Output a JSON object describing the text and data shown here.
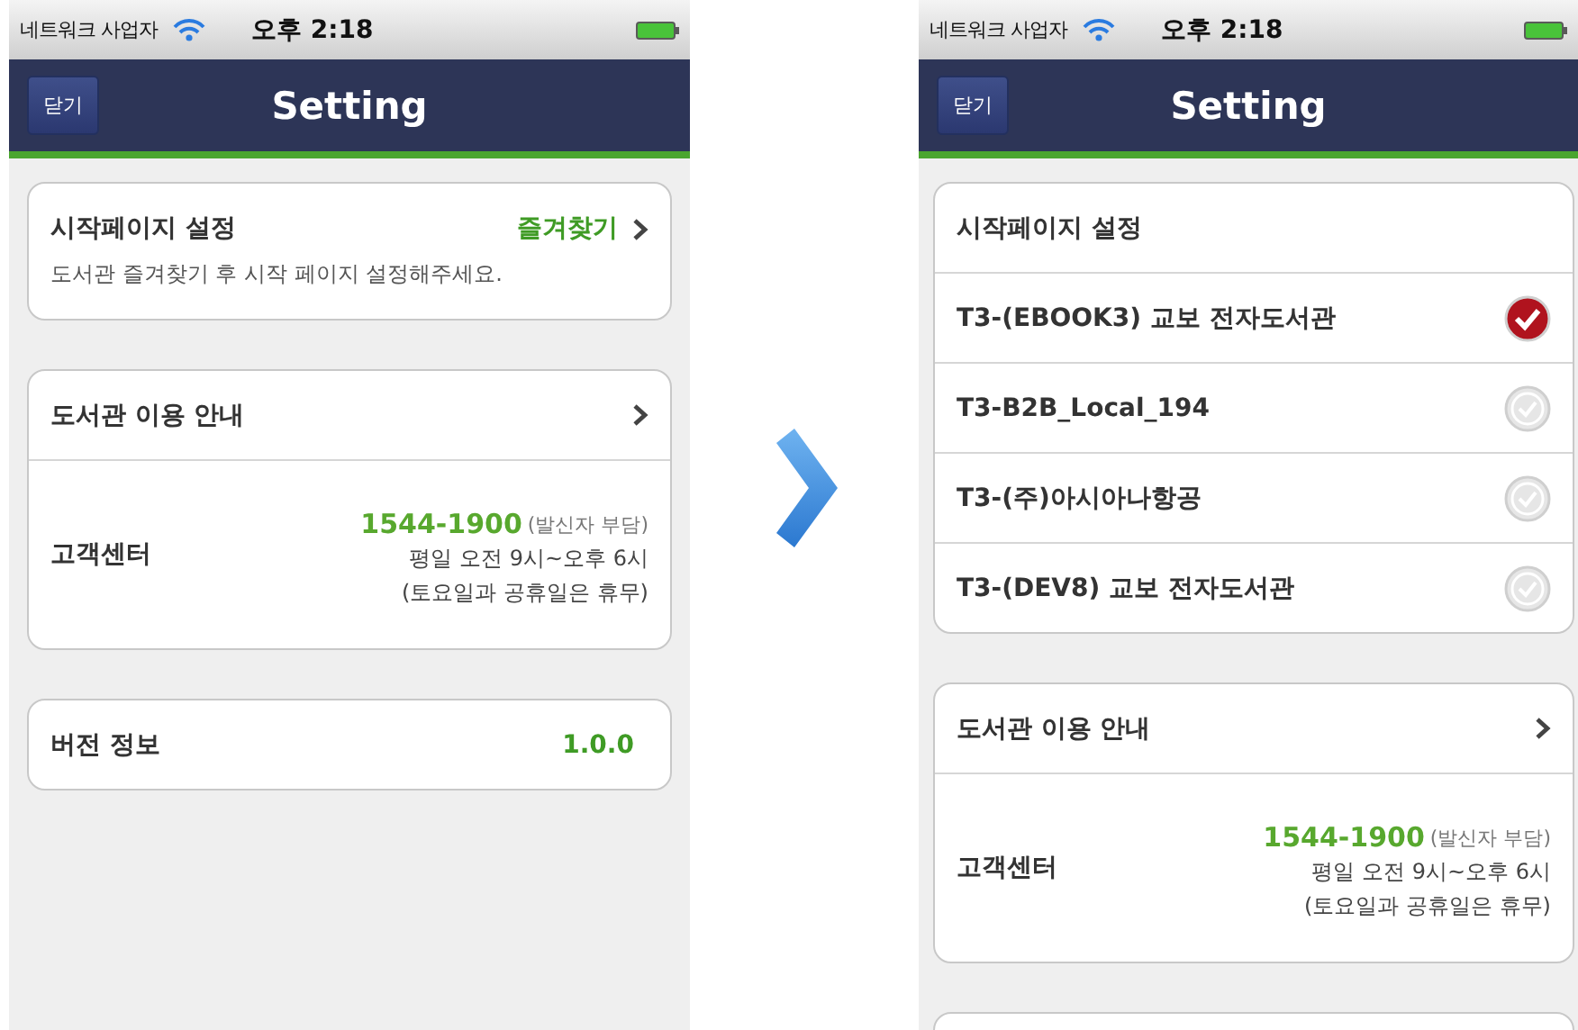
{
  "phones": [
    {
      "status_bar": {
        "carrier": "네트워크 사업자",
        "time": "오후 2:18"
      },
      "nav": {
        "close_button": "닫기",
        "title": "Setting"
      },
      "sections": [
        {
          "rows": [
            {
              "kind": "start_page",
              "label": "시작페이지 설정",
              "value": "즐겨찾기",
              "hint": "도서관 즐겨찾기 후 시작 페이지 설정해주세요."
            }
          ]
        },
        {
          "rows": [
            {
              "kind": "link",
              "label": "도서관 이용 안내"
            },
            {
              "kind": "contact",
              "label": "고객센터",
              "phone": "1544-1900",
              "phone_note": "(발신자 부담)",
              "hours": "평일 오전 9시~오후 6시",
              "note": "(토요일과 공휴일은 휴무)"
            }
          ]
        },
        {
          "rows": [
            {
              "kind": "value",
              "label": "버전 정보",
              "value": "1.0.0"
            }
          ]
        }
      ]
    },
    {
      "status_bar": {
        "carrier": "네트워크 사업자",
        "time": "오후 2:18"
      },
      "nav": {
        "close_button": "닫기",
        "title": "Setting"
      },
      "more_below": true,
      "sections": [
        {
          "rows": [
            {
              "kind": "header",
              "label": "시작페이지 설정"
            },
            {
              "kind": "option",
              "label": "T3-(EBOOK3) 교보 전자도서관",
              "selected": true
            },
            {
              "kind": "option",
              "label": "T3-B2B_Local_194",
              "selected": false
            },
            {
              "kind": "option",
              "label": "T3-(주)아시아나항공",
              "selected": false
            },
            {
              "kind": "option",
              "label": "T3-(DEV8) 교보 전자도서관",
              "selected": false
            }
          ]
        },
        {
          "rows": [
            {
              "kind": "link",
              "label": "도서관 이용 안내"
            },
            {
              "kind": "contact",
              "label": "고객센터",
              "phone": "1544-1900",
              "phone_note": "(발신자 부담)",
              "hours": "평일 오전 9시~오후 6시",
              "note": "(토요일과 공휴일은 휴무)"
            }
          ]
        }
      ]
    }
  ]
}
